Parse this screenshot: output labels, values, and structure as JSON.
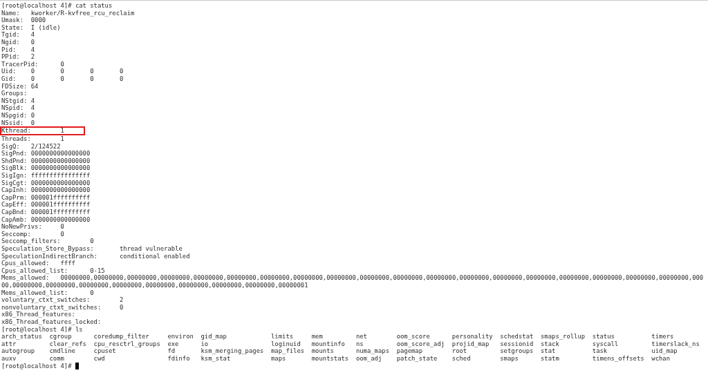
{
  "lines": [
    {
      "kind": "prompt",
      "prompt": "[root@localhost 4]#",
      "command": "cat status",
      "cursor": false
    },
    {
      "kind": "field",
      "key": "Name:",
      "values": [
        "kworker/R-kvfree_rcu_reclaim"
      ],
      "highlighted": false
    },
    {
      "kind": "field",
      "key": "Umask:",
      "values": [
        "0000"
      ],
      "highlighted": false
    },
    {
      "kind": "field",
      "key": "State:",
      "values": [
        "I (idle)"
      ],
      "highlighted": false
    },
    {
      "kind": "field",
      "key": "Tgid:",
      "values": [
        "4"
      ],
      "highlighted": false
    },
    {
      "kind": "field",
      "key": "Ngid:",
      "values": [
        "0"
      ],
      "highlighted": false
    },
    {
      "kind": "field",
      "key": "Pid:",
      "values": [
        "4"
      ],
      "highlighted": false
    },
    {
      "kind": "field",
      "key": "PPid:",
      "values": [
        "2"
      ],
      "highlighted": false
    },
    {
      "kind": "field",
      "key": "TracerPid:",
      "values": [
        "0"
      ],
      "highlighted": false
    },
    {
      "kind": "field",
      "key": "Uid:",
      "values": [
        "0",
        "0",
        "0",
        "0"
      ],
      "highlighted": false
    },
    {
      "kind": "field",
      "key": "Gid:",
      "values": [
        "0",
        "0",
        "0",
        "0"
      ],
      "highlighted": false
    },
    {
      "kind": "field",
      "key": "FDSize:",
      "values": [
        "64"
      ],
      "highlighted": false
    },
    {
      "kind": "field",
      "key": "Groups:",
      "highlighted": false
    },
    {
      "kind": "field",
      "key": "NStgid:",
      "values": [
        "4"
      ],
      "highlighted": false
    },
    {
      "kind": "field",
      "key": "NSpid:",
      "values": [
        "4"
      ],
      "highlighted": false
    },
    {
      "kind": "field",
      "key": "NSpgid:",
      "values": [
        "0"
      ],
      "highlighted": false
    },
    {
      "kind": "field",
      "key": "NSsid:",
      "values": [
        "0"
      ],
      "highlighted": false
    },
    {
      "kind": "field",
      "key": "Kthread:",
      "values": [
        "1"
      ],
      "highlighted": true
    },
    {
      "kind": "field",
      "key": "Threads:",
      "values": [
        "1"
      ],
      "highlighted": false
    },
    {
      "kind": "field",
      "key": "SigQ:",
      "values": [
        "2/124522"
      ],
      "highlighted": false
    },
    {
      "kind": "field",
      "key": "SigPnd:",
      "values": [
        "0000000000000000"
      ],
      "highlighted": false
    },
    {
      "kind": "field",
      "key": "ShdPnd:",
      "values": [
        "0000000000000000"
      ],
      "highlighted": false
    },
    {
      "kind": "field",
      "key": "SigBlk:",
      "values": [
        "0000000000000000"
      ],
      "highlighted": false
    },
    {
      "kind": "field",
      "key": "SigIgn:",
      "values": [
        "ffffffffffffffff"
      ],
      "highlighted": false
    },
    {
      "kind": "field",
      "key": "SigCgt:",
      "values": [
        "0000000000000000"
      ],
      "highlighted": false
    },
    {
      "kind": "field",
      "key": "CapInh:",
      "values": [
        "0000000000000000"
      ],
      "highlighted": false
    },
    {
      "kind": "field",
      "key": "CapPrm:",
      "values": [
        "000001ffffffffff"
      ],
      "highlighted": false
    },
    {
      "kind": "field",
      "key": "CapEff:",
      "values": [
        "000001ffffffffff"
      ],
      "highlighted": false
    },
    {
      "kind": "field",
      "key": "CapBnd:",
      "values": [
        "000001ffffffffff"
      ],
      "highlighted": false
    },
    {
      "kind": "field",
      "key": "CapAmb:",
      "values": [
        "0000000000000000"
      ],
      "highlighted": false
    },
    {
      "kind": "field",
      "key": "NoNewPrivs:",
      "values": [
        "0"
      ],
      "highlighted": false
    },
    {
      "kind": "field",
      "key": "Seccomp:",
      "values": [
        "0"
      ],
      "highlighted": false
    },
    {
      "kind": "field",
      "key": "Seccomp_filters:",
      "values": [
        "0"
      ],
      "highlighted": false
    },
    {
      "kind": "field",
      "key": "Speculation_Store_Bypass:",
      "values": [
        "thread vulnerable"
      ],
      "highlighted": false
    },
    {
      "kind": "field",
      "key": "SpeculationIndirectBranch:",
      "values": [
        "conditional enabled"
      ],
      "highlighted": false
    },
    {
      "kind": "field",
      "key": "Cpus_allowed:",
      "values": [
        "ffff"
      ],
      "highlighted": false
    },
    {
      "kind": "field",
      "key": "Cpus_allowed_list:",
      "values": [
        "0-15"
      ],
      "highlighted": false
    },
    {
      "kind": "field",
      "key": "Mems_allowed:",
      "values": [
        "00000000,00000000,00000000,00000000,00000000,00000000,00000000,00000000,00000000,00000000,00000000,00000000,00000000,00000000,00000000,00000000,00000000,00000000,00000000,000"
      ],
      "highlighted": false
    },
    {
      "kind": "field",
      "values": [
        "00,00000000,00000000,00000000,00000000,00000000,00000000,00000000,00000000,00000001"
      ],
      "highlighted": false
    },
    {
      "kind": "field",
      "key": "Mems_allowed_list:",
      "values": [
        "0"
      ],
      "highlighted": false
    },
    {
      "kind": "field",
      "key": "voluntary_ctxt_switches:",
      "values": [
        "2"
      ],
      "highlighted": false
    },
    {
      "kind": "field",
      "key": "nonvoluntary_ctxt_switches:",
      "values": [
        "0"
      ],
      "highlighted": false
    },
    {
      "kind": "field",
      "key": "x86_Thread_features:",
      "highlighted": false
    },
    {
      "kind": "field",
      "key": "x86_Thread_features_locked:",
      "highlighted": false
    },
    {
      "kind": "prompt",
      "prompt": "[root@localhost 4]#",
      "command": "ls",
      "cursor": false
    },
    {
      "kind": "listing",
      "columns": [
        [
          "arch_status",
          "attr",
          "autogroup",
          "auxv"
        ],
        [
          "cgroup",
          "clear_refs",
          "cmdline",
          "comm"
        ],
        [
          "coredump_filter",
          "cpu_resctrl_groups",
          "cpuset",
          "cwd"
        ],
        [
          "environ",
          "exe",
          "fd",
          "fdinfo"
        ],
        [
          "gid_map",
          "io",
          "ksm_merging_pages",
          "ksm_stat"
        ],
        [
          "limits",
          "loginuid",
          "map_files",
          "maps"
        ],
        [
          "mem",
          "mountinfo",
          "mounts",
          "mountstats"
        ],
        [
          "net",
          "ns",
          "numa_maps",
          "oom_adj"
        ],
        [
          "oom_score",
          "oom_score_adj",
          "pagemap",
          "patch_state"
        ],
        [
          "personality",
          "projid_map",
          "root",
          "sched"
        ],
        [
          "schedstat",
          "sessionid",
          "setgroups",
          "smaps"
        ],
        [
          "smaps_rollup",
          "stack",
          "stat",
          "statm"
        ],
        [
          "status",
          "syscall",
          "task",
          "timens_offsets"
        ],
        [
          "timers",
          "timerslack_ns",
          "uid_map",
          "wchan"
        ]
      ]
    },
    {
      "kind": "prompt",
      "prompt": "[root@localhost 4]#",
      "cursor": true
    }
  ]
}
